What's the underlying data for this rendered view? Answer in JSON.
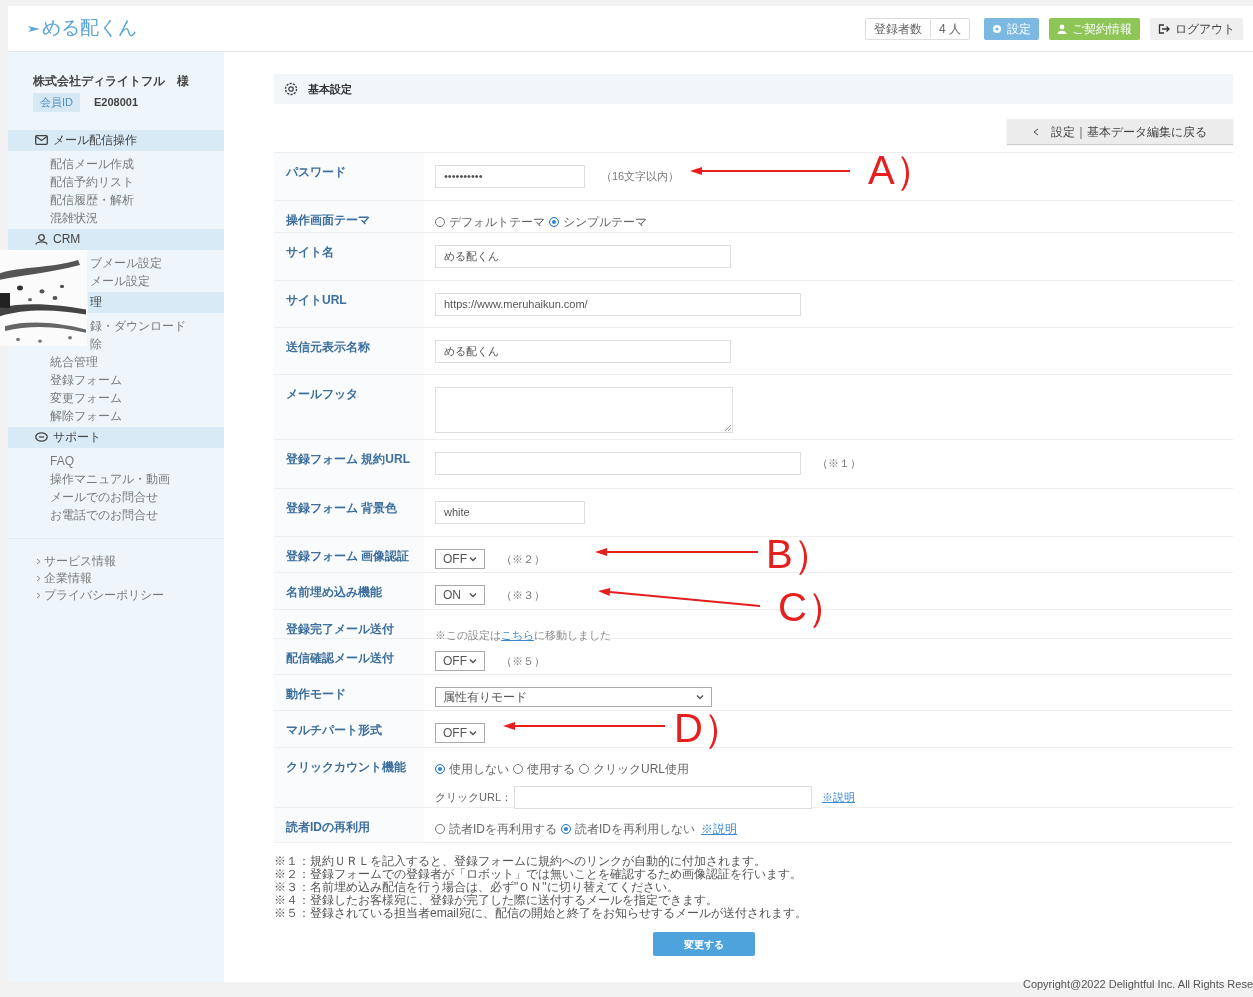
{
  "header": {
    "logo": "める配くん",
    "registrants": {
      "label": "登録者数",
      "value": "4 人"
    },
    "buttons": [
      {
        "kind": "settings",
        "label": "設定"
      },
      {
        "kind": "contract",
        "label": "ご契約情報"
      },
      {
        "kind": "logout",
        "label": "ログアウト"
      }
    ]
  },
  "sidebar": {
    "company": "株式会社ディライトフル　様",
    "member_id": {
      "label": "会員ID",
      "value": "E208001"
    },
    "sections": [
      {
        "title": "メール配信操作",
        "items": [
          "配信メール作成",
          "配信予約リスト",
          "配信履歴・解析",
          "混雑状況"
        ]
      },
      {
        "title": "CRM",
        "items": [
          "ブメール設定",
          "メール設定"
        ]
      },
      {
        "title": "理",
        "items": [
          "録・ダウンロード",
          "除",
          "統合管理",
          "登録フォーム",
          "変更フォーム",
          "解除フォーム"
        ]
      },
      {
        "title": "サポート",
        "items": [
          "FAQ",
          "操作マニュアル・動画",
          "メールでのお問合せ",
          "お電話でのお問合せ"
        ]
      }
    ],
    "links": [
      "サービス情報",
      "企業情報",
      "プライバシーポリシー"
    ]
  },
  "overlay": {
    "kind": "picture"
  },
  "main": {
    "title": "基本設定",
    "back_button": "設定｜基本データ編集に戻る",
    "rows": [
      {
        "label": "パスワード",
        "kind": "input-short",
        "value": "••••••••••",
        "note": "（16文字以内）"
      },
      {
        "label": "操作画面テーマ",
        "kind": "radio",
        "options": [
          {
            "label": "デフォルトテーマ",
            "selected": false
          },
          {
            "label": "シンプルテーマ",
            "selected": true
          }
        ]
      },
      {
        "label": "サイト名",
        "kind": "input",
        "value": "める配くん"
      },
      {
        "label": "サイトURL",
        "kind": "input-long",
        "value": "https://www.meruhaikun.com/"
      },
      {
        "label": "送信元表示名称",
        "kind": "input",
        "value": "める配くん"
      },
      {
        "label": "メールフッタ",
        "kind": "textarea"
      },
      {
        "label": "登録フォーム 規約URL",
        "kind": "input-long",
        "note": "（※１）"
      },
      {
        "label": "登録フォーム 背景色",
        "kind": "input-short",
        "value": "white"
      },
      {
        "label": "登録フォーム 画像認証",
        "kind": "select",
        "value": "OFF",
        "note": "（※２）"
      },
      {
        "label": "名前埋め込み機能",
        "kind": "select",
        "value": "ON",
        "note": "（※３）"
      },
      {
        "label": "登録完了メール送付",
        "kind": "link-text",
        "before": "※この設定は",
        "link": "こちら",
        "after": "に移動しました"
      },
      {
        "label": "配信確認メール送付",
        "kind": "select",
        "value": "OFF",
        "note": "（※５）"
      },
      {
        "label": "動作モード",
        "kind": "select-long",
        "value": "属性有りモード"
      },
      {
        "label": "マルチパート形式",
        "kind": "select",
        "value": "OFF"
      },
      {
        "label": "クリックカウント機能",
        "kind": "radio",
        "options": [
          {
            "label": "使用しない",
            "selected": true
          },
          {
            "label": "使用する",
            "selected": false
          },
          {
            "label": "クリックURL使用",
            "selected": false
          }
        ],
        "sub_label": "クリックURL：",
        "link": "※説明"
      },
      {
        "label": "読者IDの再利用",
        "kind": "radio",
        "options": [
          {
            "label": "読者IDを再利用する",
            "selected": false
          },
          {
            "label": "読者IDを再利用しない",
            "selected": true
          }
        ],
        "link": "※説明"
      }
    ],
    "notes": [
      "※１：規約ＵＲＬを記入すると、登録フォームに規約へのリンクが自動的に付加されます。",
      "※２：登録フォームでの登録者が「ロボット」では無いことを確認するため画像認証を行います。",
      "※３：名前埋め込み配信を行う場合は、必ず\"ＯＮ\"に切り替えてください。",
      "※４：登録したお客様宛に、登録が完了した際に送付するメールを指定できます。",
      "※５：登録されている担当者email宛に、配信の開始と終了をお知らせするメールが送付されます。"
    ],
    "submit": "変更する"
  },
  "annotations": [
    "A）",
    "B）",
    "C）",
    "D）"
  ],
  "copyright": "Copyright@2022 Delightful Inc. All Rights Rese"
}
